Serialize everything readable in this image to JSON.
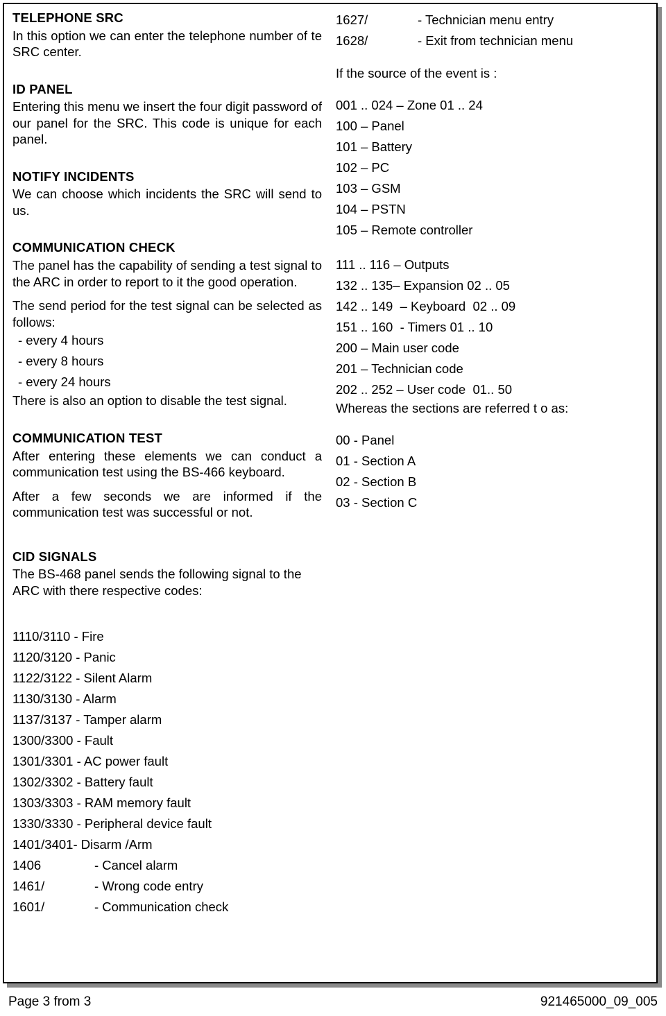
{
  "document": {
    "left_column": {
      "sections": [
        {
          "heading": "TELEPHONE SRC",
          "paragraphs": [
            "In this option we can enter the telephone number of te SRC center."
          ]
        },
        {
          "heading": "ID PANEL",
          "paragraphs": [
            "Entering this menu we insert the four digit password of our panel for the SRC. This code is unique for each panel."
          ]
        },
        {
          "heading": "NOTIFY INCIDENTS",
          "paragraphs": [
            "We can choose which incidents the SRC will send to us."
          ]
        },
        {
          "heading": "COMMUNICATION CHECK",
          "paragraphs": [
            "The panel has the capability of sending a test signal to the ARC in order to report to it the good operation.",
            "The send period for the test signal can be selected  as follows:"
          ],
          "bullets": [
            "- every 4 hours",
            "- every 8 hours",
            "- every 24 hours"
          ],
          "paragraphs_after": [
            "There is also an option to disable the test signal."
          ]
        },
        {
          "heading": "COMMUNICATION TEST",
          "paragraphs": [
            "After entering these elements we can conduct a communication test using the BS-466 keyboard.",
            "After a few seconds we are informed if the communication test was successful or not."
          ]
        },
        {
          "heading": "CID SIGNALS",
          "paragraphs": [
            "The BS-468 panel sends the following signal to the ARC with there respective codes:"
          ]
        }
      ],
      "cid_codes": [
        {
          "code": "1110/3110 - ",
          "label": "Fire"
        },
        {
          "code": "1120/3120 - ",
          "label": "Panic"
        },
        {
          "code": "1122/3122 - ",
          "label": "Silent Alarm"
        },
        {
          "code": "1130/3130 - ",
          "label": "Alarm"
        },
        {
          "code": "1137/3137 - ",
          "label": "Tamper alarm"
        },
        {
          "code": "1300/3300 - ",
          "label": "Fault"
        },
        {
          "code": "1301/3301 - ",
          "label": "AC power fault"
        },
        {
          "code": "1302/3302 - ",
          "label": "Battery fault"
        },
        {
          "code": "1303/3303 - ",
          "label": "RAM memory fault"
        },
        {
          "code": "1330/3330 - ",
          "label": "Peripheral device fault"
        },
        {
          "code": "1401/3401- ",
          "label": "Disarm /Arm"
        }
      ],
      "cid_codes_spaced": [
        {
          "key": "1406",
          "value": "- Cancel alarm"
        },
        {
          "key": "1461/",
          "value": "- Wrong code entry"
        },
        {
          "key": "1601/",
          "value": "- Communication check"
        }
      ]
    },
    "right_column": {
      "cid_codes_spaced": [
        {
          "key": "1627/",
          "value": "- Technician menu entry"
        },
        {
          "key": "1628/",
          "value": "- Exit from technician menu"
        }
      ],
      "event_source_intro": "If the source of the event is :",
      "event_sources": [
        "001 .. 024 – Zone 01 .. 24",
        "100 – Panel",
        "101 – Battery",
        "102 – PC",
        "103 – GSM",
        "104 – PSTN",
        "105 – Remote controller"
      ],
      "device_sources": [
        "111 .. 116 – Outputs",
        "132 .. 135– Expansion 02 .. 05",
        "142 .. 149  – Keyboard  02 .. 09",
        "151 .. 160  - Timers 01 .. 10",
        "200 – Main user code",
        "201 – Technician code",
        "202 .. 252 – User code  01.. 50"
      ],
      "sections_intro": "Whereas the sections are referred t o as:",
      "sections_list": [
        "00 - Panel",
        "01 - Section A",
        "02 - Section B",
        "03 - Section C"
      ]
    },
    "footer": {
      "page_label": "Page 3 from 3",
      "document_code": "921465000_09_005"
    }
  }
}
